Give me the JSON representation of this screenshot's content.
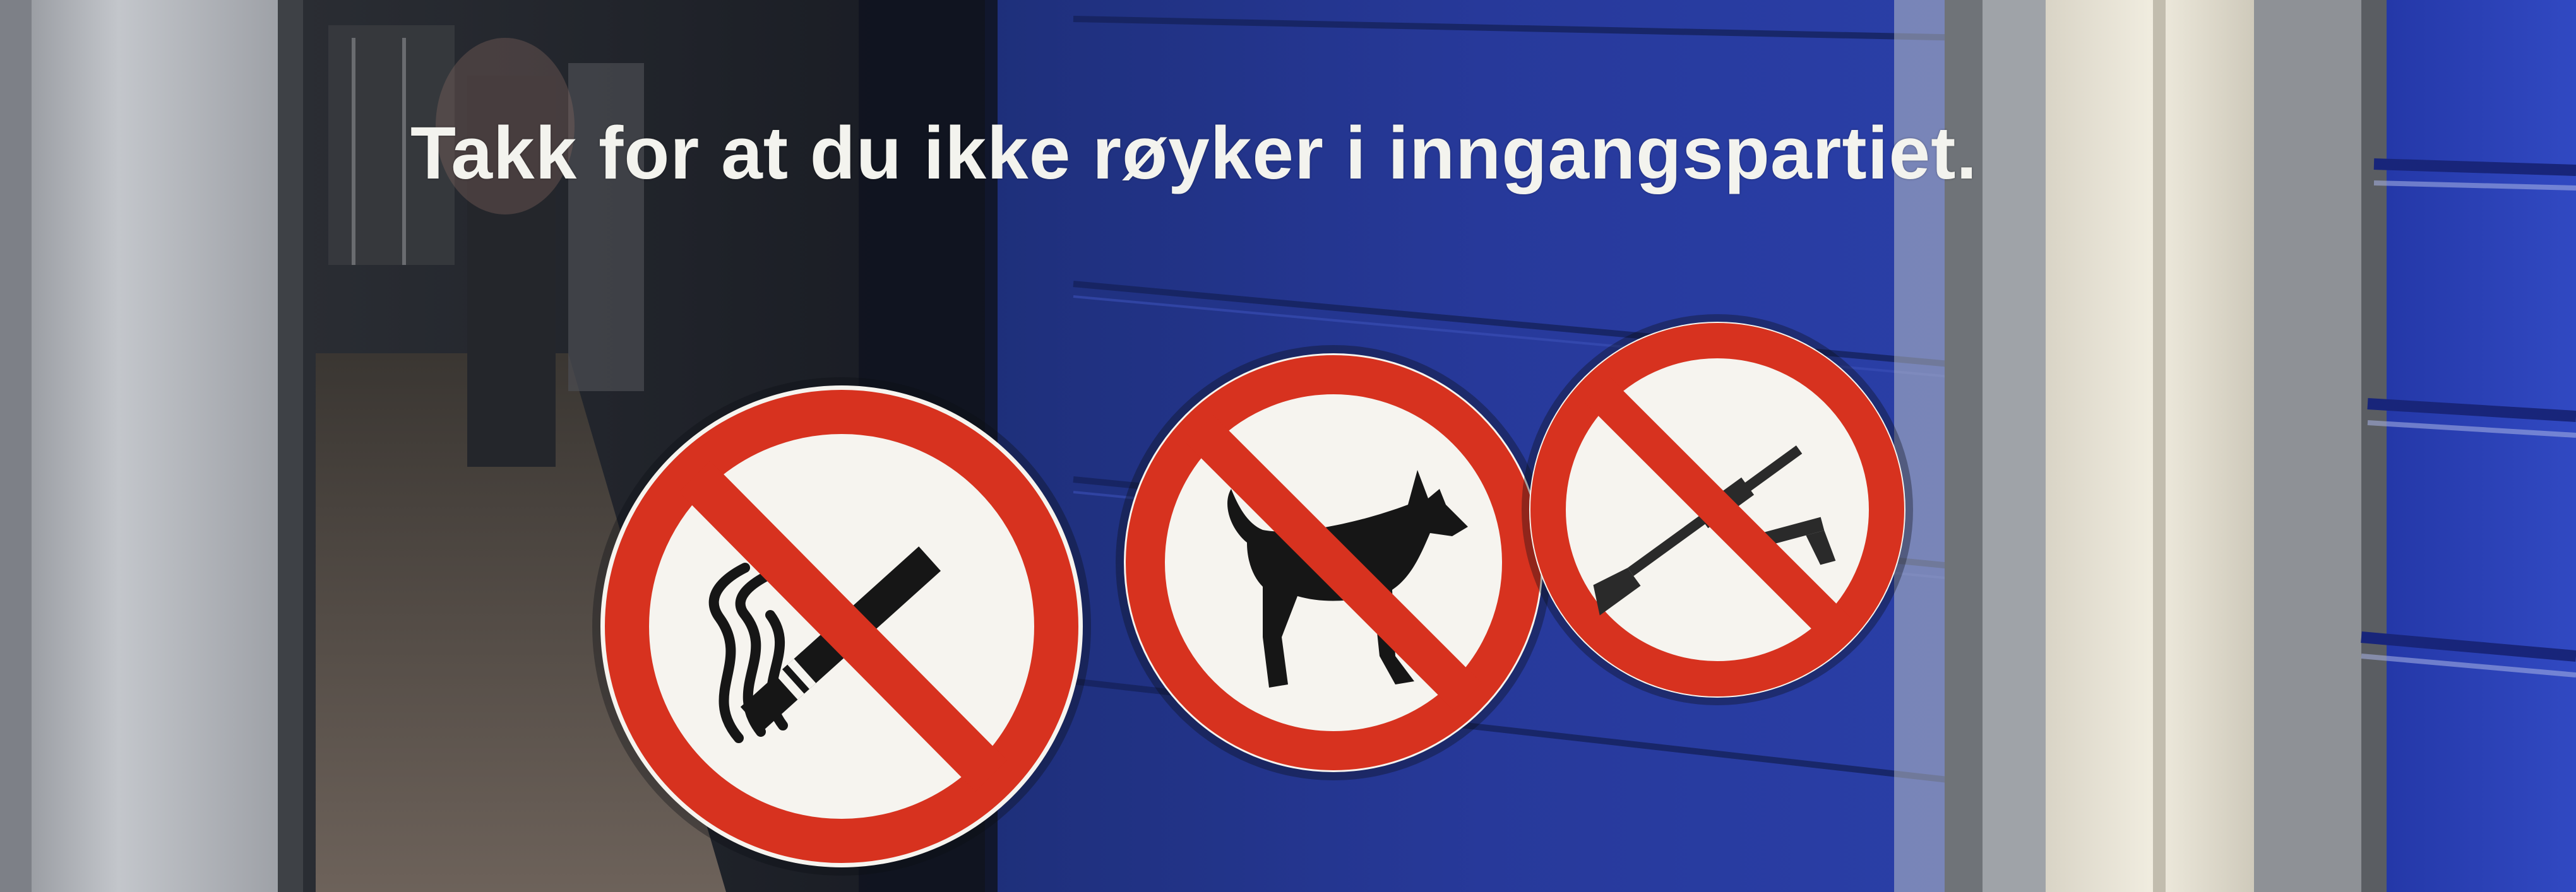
{
  "scene": {
    "description_tag": "glass-door-with-prohibition-stickers",
    "caption": "Takk for at du ikke røyker i inngangspartiet.",
    "signs": [
      {
        "name": "no-smoking-sign",
        "icon": "cigarette-icon"
      },
      {
        "name": "no-dogs-sign",
        "icon": "dog-icon"
      },
      {
        "name": "no-weapons-sign",
        "icon": "rifle-and-pistol-icon"
      }
    ],
    "colors": {
      "prohibition_red": "#d7321f",
      "sign_white": "#f6f4ef",
      "symbol_black": "#161616",
      "wall_blue": "#2a3f9c",
      "frame_grey": "#b8bcc2",
      "trim_cream": "#ece7d8"
    }
  }
}
